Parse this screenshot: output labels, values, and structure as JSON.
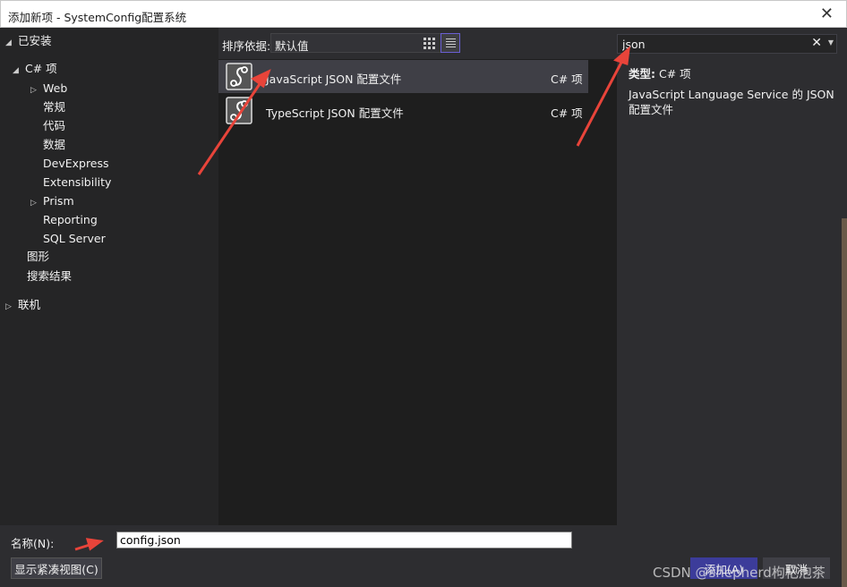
{
  "window": {
    "title": "添加新项 - SystemConfig配置系统",
    "close_glyph": "✕"
  },
  "sidebar": {
    "installed": "已安装",
    "csharp": "C# 项",
    "items": [
      "Web",
      "常规",
      "代码",
      "数据",
      "DevExpress",
      "Extensibility",
      "Prism",
      "Reporting",
      "SQL Server"
    ],
    "graphics": "图形",
    "search_results": "搜索结果",
    "online": "联机"
  },
  "toolbar": {
    "sort_label": "排序依据:",
    "sort_value": "默认值"
  },
  "templates": [
    {
      "name": "JavaScript JSON 配置文件",
      "lang": "C# 项",
      "icon": "json-file-icon"
    },
    {
      "name": "TypeScript JSON 配置文件",
      "lang": "C# 项",
      "icon": "json-file-icon"
    }
  ],
  "search": {
    "value": "json",
    "clear_glyph": "✕"
  },
  "details": {
    "type_label": "类型:",
    "type_value": "C# 项",
    "description": "JavaScript Language Service 的 JSON 配置文件"
  },
  "bottom": {
    "name_label": "名称(N):",
    "name_value": "config.json",
    "compact_view": "显示紧凑视图(C)",
    "add": "添加(A)",
    "cancel": "取消"
  },
  "watermark": "CSDN @shepherd枸杞泡茶",
  "colors": {
    "accent": "#6a5fd3",
    "annotation": "#e8443a",
    "selected_row": "#3f3f46"
  }
}
